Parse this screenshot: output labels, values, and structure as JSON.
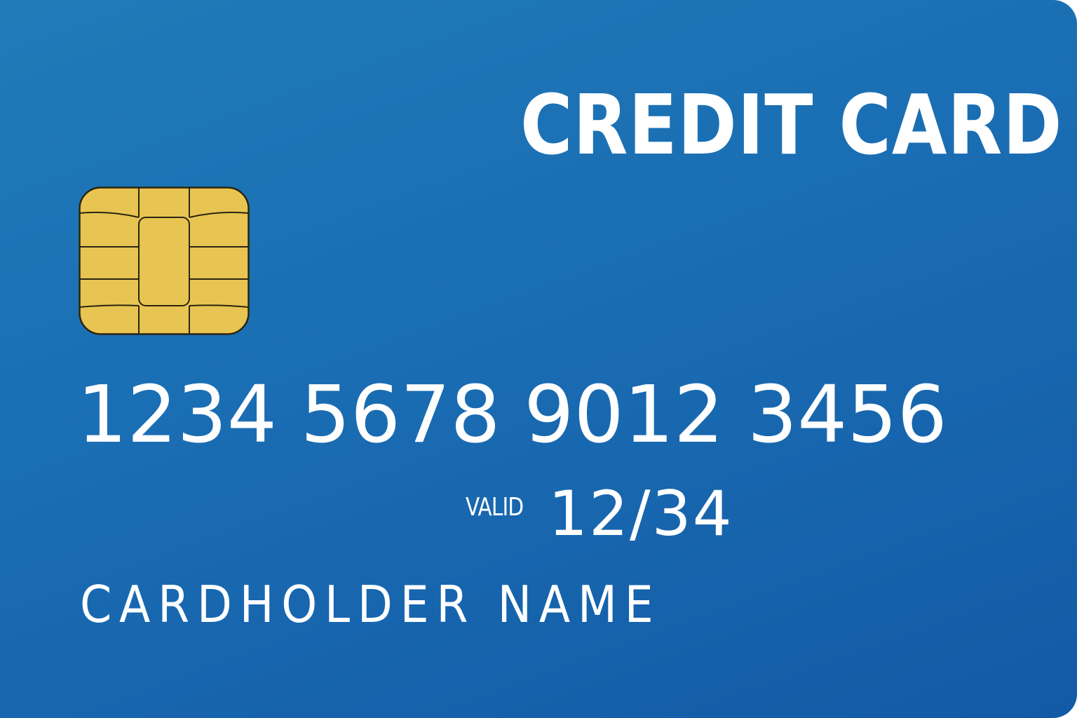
{
  "card": {
    "title": "CREDIT CARD",
    "number": "1234 5678 9012 3456",
    "valid_label": "VALID",
    "valid_date": "12/34",
    "holder_name": "CARDHOLDER NAME"
  },
  "colors": {
    "card_background": "#1a6db3",
    "chip_gold": "#e8c552",
    "text": "#ffffff"
  },
  "icons": [
    "emv-chip-icon"
  ]
}
